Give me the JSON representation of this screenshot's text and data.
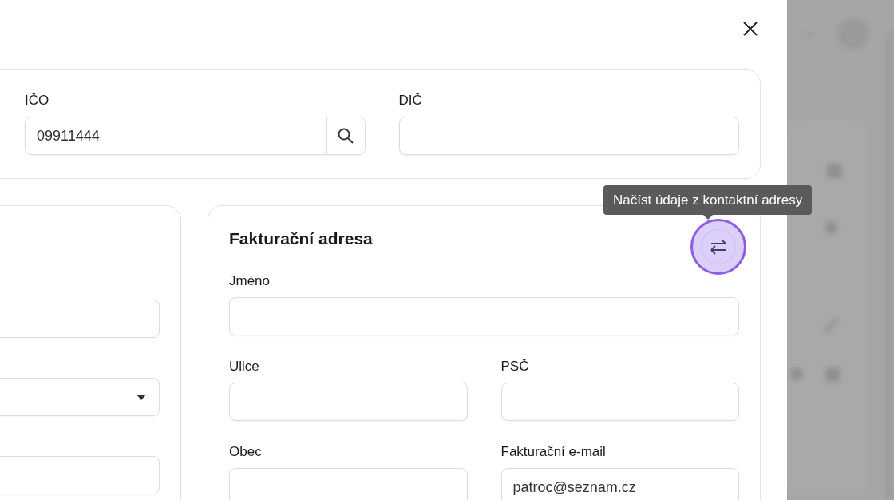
{
  "company": {
    "fields": [
      {
        "label": "IČO",
        "value": "09911444",
        "kind": "search"
      },
      {
        "label": "DIČ",
        "kind": "text"
      }
    ]
  },
  "contact_card": {
    "fields": [
      {
        "kind": "text"
      },
      {
        "kind": "select"
      },
      {
        "kind": "text"
      }
    ]
  },
  "billing_card": {
    "title": "Fakturační adresa",
    "tooltip": "Načíst údaje z kontaktní adresy",
    "fields": [
      {
        "label": "Jméno",
        "wide": true
      },
      {
        "label": "Ulice",
        "wide": false
      },
      {
        "label": "PSČ",
        "wide": false
      },
      {
        "label": "Obec",
        "wide": false
      },
      {
        "label": "Fakturační e-mail",
        "value": "patroc@seznam.cz",
        "wide": false
      }
    ]
  }
}
